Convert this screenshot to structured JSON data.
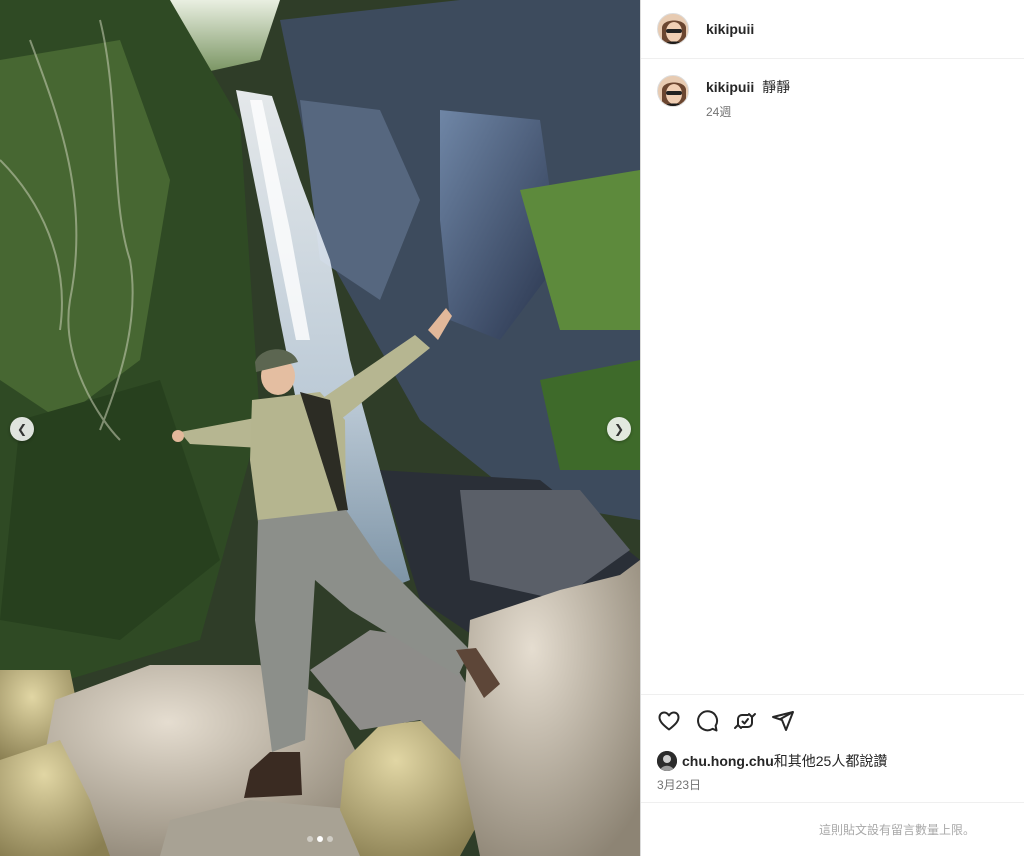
{
  "post": {
    "author": "kikipuii",
    "caption_user": "kikipuii",
    "caption_text": "靜靜",
    "caption_time": "24週",
    "liked_by_user": "chu.hong.chu",
    "liked_by_rest": "和其他25人都說讚",
    "date": "3月23日",
    "comments_limit_notice": "這則貼文設有留言數量上限。"
  },
  "media": {
    "prev_glyph": "❮",
    "next_glyph": "❯",
    "slide_count": 3,
    "active_slide": 2
  },
  "icons": [
    "heart-icon",
    "comment-icon",
    "repost-icon",
    "share-icon",
    "chevron-left-icon",
    "chevron-right-icon"
  ]
}
